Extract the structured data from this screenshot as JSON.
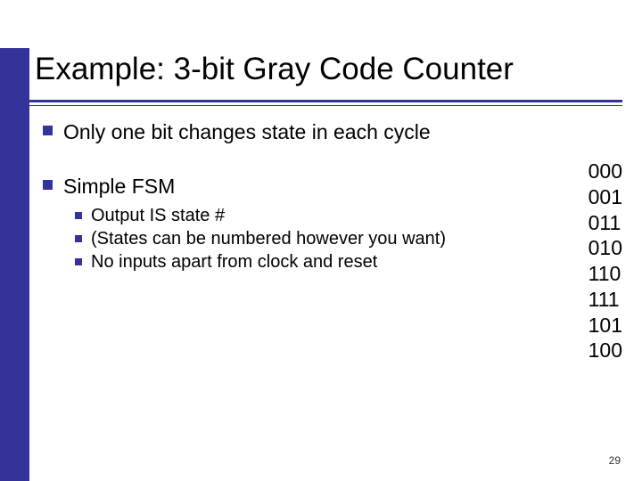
{
  "slide": {
    "title": "Example: 3-bit Gray Code Counter",
    "page_number": "29"
  },
  "bullets": {
    "b1": "Only one bit changes state in each cycle",
    "b2": "Simple FSM",
    "sub1": "Output IS state #",
    "sub2": "(States can be numbered however you want)",
    "sub3": "No inputs apart from clock and reset"
  },
  "gray_codes": {
    "c0": "000",
    "c1": "001",
    "c2": "011",
    "c3": "010",
    "c4": "110",
    "c5": "111",
    "c6": "101",
    "c7": "100"
  }
}
